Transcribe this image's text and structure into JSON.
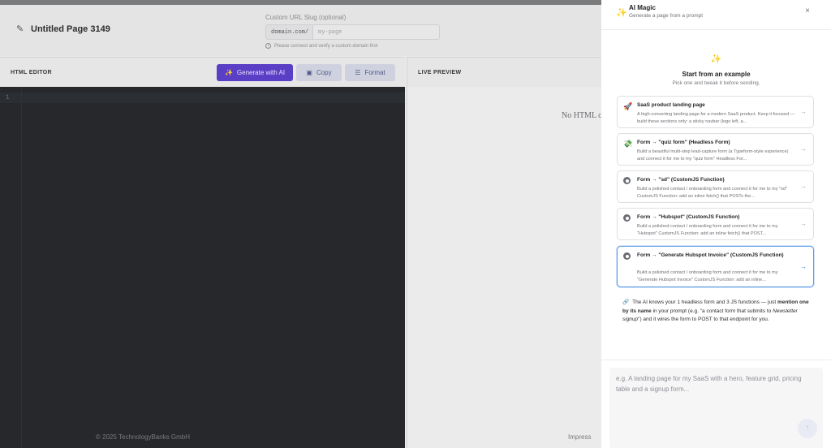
{
  "editor_page": {
    "title": "Untitled Page 3149",
    "slug": {
      "label": "Custom URL Slug (optional)",
      "prefix": "domain.com/",
      "placeholder": "my-page",
      "note": "Please connect and verify a custom domain first"
    },
    "html_editor": {
      "label": "HTML EDITOR",
      "generate_label": "Generate with AI",
      "copy_label": "Copy",
      "format_label": "Format",
      "line_number": "1"
    },
    "live_preview": {
      "label": "LIVE PREVIEW",
      "empty_text": "No HTML c"
    },
    "footer": {
      "left": "© 2025 TechnologyBanks GmbH",
      "right": "Impress"
    }
  },
  "ai_panel": {
    "title": "AI Magic",
    "subtitle": "Generate a page from a prompt",
    "start_title": "Start from an example",
    "start_subtitle": "Pick one and tweak it before sending.",
    "examples": [
      {
        "icon": "rocket-icon",
        "title": "SaaS product landing page",
        "description": "A high-converting landing page for a modern SaaS product. Keep it focused — build these sections only: a sticky navbar (logo left, a..."
      },
      {
        "icon": "form-icon",
        "title": "Form → \"quiz form\" (Headless Form)",
        "description": "Build a beautiful multi-step lead-capture form (a Typeform-style experience) and connect it for me to my \"quiz form\" Headless For..."
      },
      {
        "icon": "gear-icon",
        "title": "Form → \"sd\" (CustomJS Function)",
        "description": "Build a polished contact / onboarding form and connect it for me to my \"sd\" CustomJS Function: add an inline fetch() that POSTs the..."
      },
      {
        "icon": "gear-icon",
        "title": "Form → \"Hubspot\" (CustomJS Function)",
        "description": "Build a polished contact / onboarding form and connect it for me to my \"Hubspot\" CustomJS Function: add an inline fetch() that POST..."
      },
      {
        "icon": "gear-icon",
        "title": "Form → \"Generate Hubspot Invoice\" (CustomJS Function)",
        "description": "Build a polished contact / onboarding form and connect it for me to my \"Generate Hubspot Invoice\" CustomJS Function: add an inline..."
      }
    ],
    "hint": {
      "part1": "The AI knows your 1 headless form and 3 JS functions — just ",
      "bold": "mention one by its name",
      "part2": " in your prompt (e.g. \"a contact form that submits to ",
      "italic": "Newsletter signup",
      "part3": "\") and it wires the form to POST to that endpoint for you."
    },
    "prompt_placeholder": "e.g. A landing page for my SaaS with a hero, feature grid, pricing table and a signup form...",
    "colors": {
      "accent": "#5b3ec6",
      "active_border": "#5b9be6"
    }
  }
}
